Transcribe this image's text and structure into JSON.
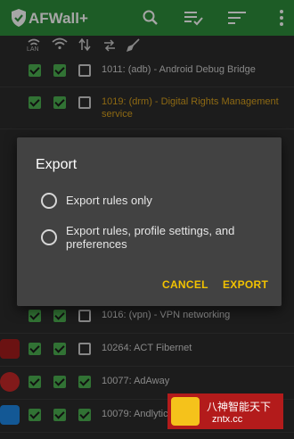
{
  "appbar": {
    "title": "AFWall+",
    "icons": [
      "shield-icon",
      "search-icon",
      "apply-list-icon",
      "sort-icon",
      "overflow-menu-icon"
    ]
  },
  "columns": {
    "lan_label": "LAN"
  },
  "rows": [
    {
      "label": "1011: (adb) - Android Debug Bridge",
      "lan": true,
      "wifi": true,
      "mobile": false,
      "color": "#d0d0d0"
    },
    {
      "label": "1019: (drm) - Digital Rights Management",
      "label_line2": "service",
      "lan": true,
      "wifi": true,
      "mobile": false,
      "color": "#d9a11e"
    },
    {
      "label": "1016: (vpn) - VPN networking",
      "lan": true,
      "wifi": true,
      "mobile": false
    },
    {
      "label": "10264: ACT Fibernet",
      "lan": true,
      "wifi": true,
      "mobile": false
    },
    {
      "label": "10077: AdAway",
      "lan": true,
      "wifi": true,
      "mobile": true
    },
    {
      "label": "10079: Andlytics",
      "lan": true,
      "wifi": true,
      "mobile": true
    }
  ],
  "dialog": {
    "title": "Export",
    "options": [
      {
        "label": "Export rules only",
        "selected": false
      },
      {
        "label": "Export rules, profile settings, and preferences",
        "selected": false
      }
    ],
    "cancel_label": "CANCEL",
    "export_label": "EXPORT"
  },
  "watermark": {
    "line1": "八神智能天下",
    "line2": "zntx.cc"
  },
  "colors": {
    "appbar": "#2d8e3b",
    "checkbox_on": "#4caf50",
    "accent_button": "#f2c200",
    "system_app_label": "#d9a11e"
  }
}
